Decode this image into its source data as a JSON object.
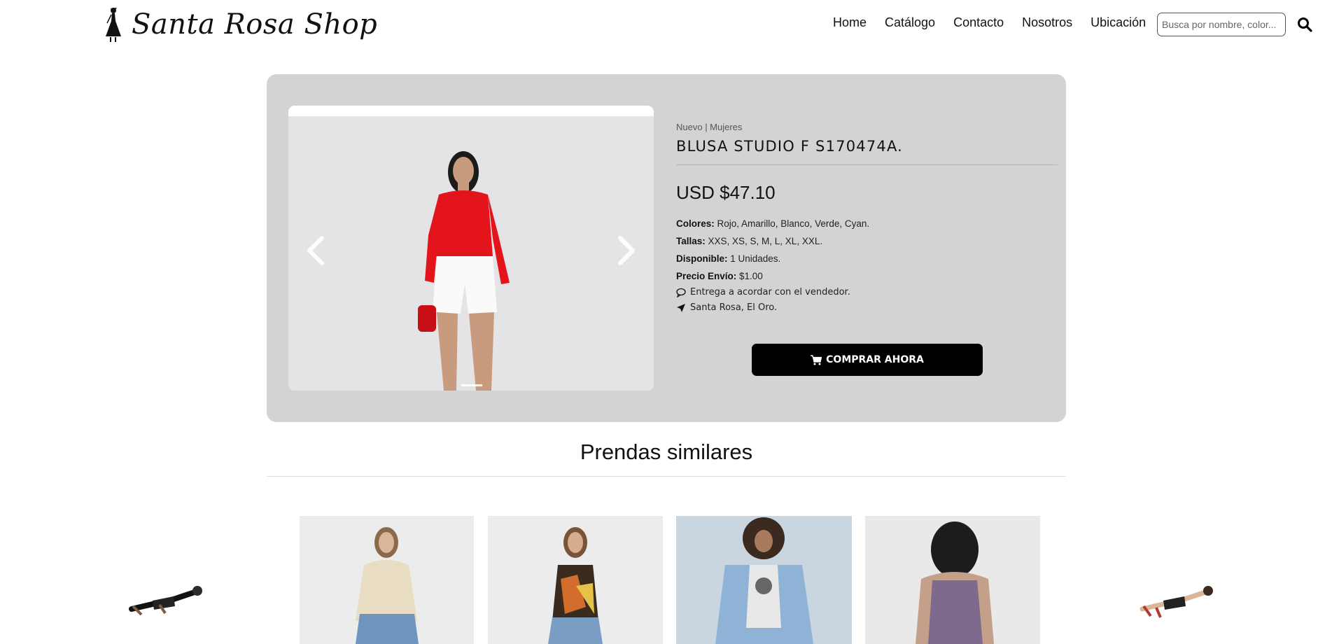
{
  "brand": {
    "name": "Santa Rosa Shop",
    "logo_icon": "lady-silhouette-icon"
  },
  "nav": {
    "links": [
      "Home",
      "Catálogo",
      "Contacto",
      "Nosotros",
      "Ubicación"
    ],
    "search_placeholder": "Busca por nombre, color...",
    "search_icon": "search-icon"
  },
  "product": {
    "breadcrumb": "Nuevo | Mujeres",
    "title": "BLUSA STUDIO F S170474A.",
    "price": "USD $47.10",
    "specs": [
      {
        "label": "Colores:",
        "value": " Rojo, Amarillo, Blanco, Verde, Cyan."
      },
      {
        "label": "Tallas:",
        "value": " XXS, XS, S, M, L, XL, XXL."
      },
      {
        "label": "Disponible:",
        "value": " 1 Unidades."
      },
      {
        "label": "Precio Envío:",
        "value": " $1.00"
      }
    ],
    "delivery": "Entrega a acordar con el vendedor.",
    "location": "Santa Rosa, El Oro.",
    "buy_label": "COMPRAR AHORA",
    "image_icon": "model-red-top-image"
  },
  "similar": {
    "title": "Prendas similares",
    "items": [
      "beige-shirt-jeans-image",
      "printed-halter-top-image",
      "denim-jacket-image",
      "purple-knit-top-back-image"
    ]
  },
  "colors": {
    "panel_bg": "#d3d3d3",
    "buy_button": "#000000",
    "accent_red": "#e3141c"
  }
}
